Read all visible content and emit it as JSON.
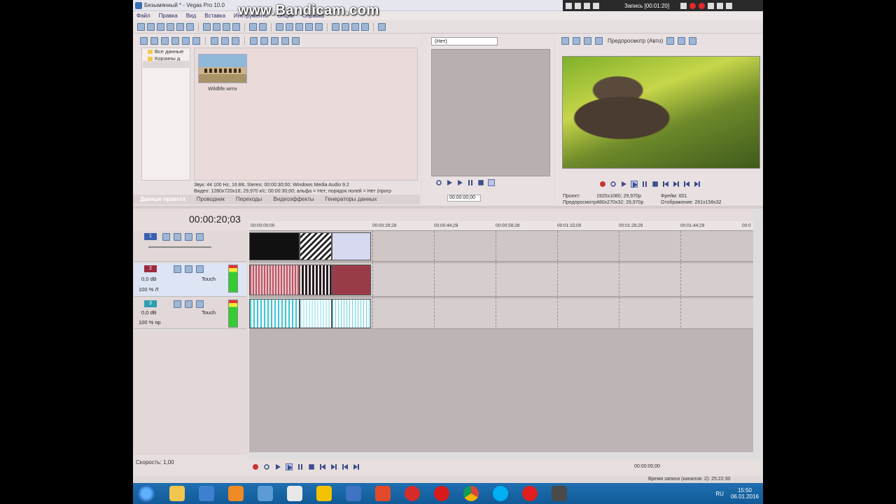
{
  "watermark": "www.Bandicam.com",
  "window": {
    "title": "Безымянный * - Vegas Pro 10.0"
  },
  "recorder": {
    "status": "Запись [00:01:20]"
  },
  "menu": [
    "Файл",
    "Правка",
    "Вид",
    "Вставка",
    "Инструменты",
    "Опции",
    "Справка"
  ],
  "explorer": {
    "tree": [
      "Все данные",
      "Корзины д"
    ],
    "media": [
      {
        "name": "Wildlife.wmv"
      }
    ],
    "info_audio": "Звук: 44 100 Hz, 16 Bit, Stereo; 00:00:30;00; Windows Media Audio 9.2",
    "info_video": "Видео: 1280x720x16; 29,970 к/с; 00:00:30;00; альфа = Нет; порядок полей = Нет (прогр",
    "tabs": [
      "Данные проекта",
      "Проводник",
      "Переходы",
      "Видеоэффекты",
      "Генераторы данных"
    ]
  },
  "trimmer": {
    "select": "(Нет)",
    "time": "00:00:00;00"
  },
  "preview": {
    "mode": "Предпросмотр (Авто)",
    "project_label": "Проект:",
    "project_value": "1920x1080; 29,970p",
    "preview_label": "Предпросмотр:",
    "preview_value": "480x270x32; 29,970p",
    "frame_label": "Фрейм:",
    "frame_value": "601",
    "display_label": "Отображение:",
    "display_value": "281x158x32"
  },
  "timeline": {
    "timecode": "00:00:20;03",
    "ruler": [
      "00:00:00;00",
      "00:00:29;29",
      "00:00:44;29",
      "00:00:59;28",
      "00:01:15;00",
      "00:01:29;29",
      "00:01:44;29",
      "00:0"
    ],
    "tracks": [
      {
        "number": "1",
        "color": "#3a5fb0",
        "type": "video"
      },
      {
        "number": "2",
        "color": "#9e2a3f",
        "volume": "0,0 dB",
        "mode": "Touch",
        "pan": "100 % Л"
      },
      {
        "number": "3",
        "color": "#2e9fb0",
        "volume": "0,0 dB",
        "mode": "Touch",
        "pan": "100 % пр"
      }
    ],
    "rate": "Скорость: 1,00",
    "time": "00:00:00;00"
  },
  "status": "Время записи (каналов: 2): 25:22:30",
  "taskbar": {
    "lang": "RU",
    "time": "15:50",
    "date": "06.01.2016"
  },
  "colors": {
    "accent": "#3b4d8a",
    "video_track": "#3a5fb0",
    "audio_track_2": "#9e2a3f",
    "audio_track_3": "#2e9fb0"
  }
}
